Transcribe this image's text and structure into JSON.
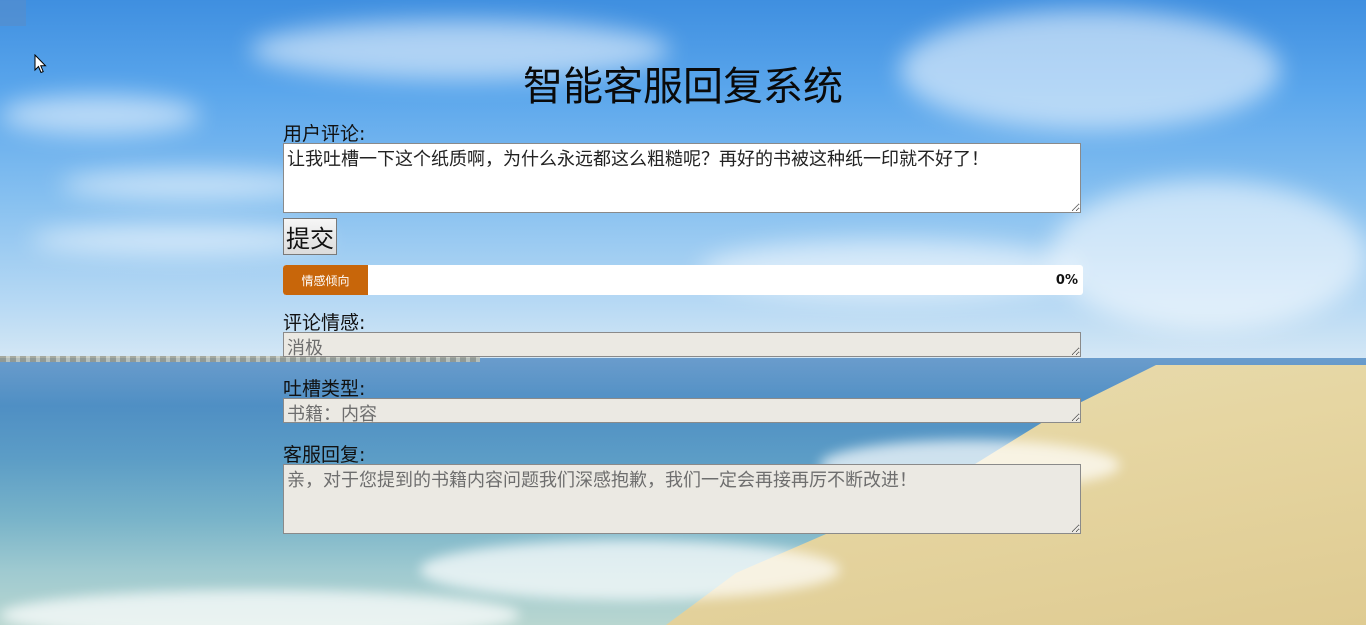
{
  "page": {
    "title": "智能客服回复系统"
  },
  "form": {
    "comment_label": "用户评论:",
    "comment_value": "让我吐槽一下这个纸质啊，为什么永远都这么粗糙呢？再好的书被这种纸一印就不好了！",
    "submit_label": "提交",
    "sentiment_bar": {
      "label": "情感倾向",
      "percent_text": "0%",
      "value": 0,
      "color": "#c8660a"
    },
    "sentiment_label": "评论情感:",
    "sentiment_value": "消极",
    "complaint_type_label": "吐槽类型:",
    "complaint_type_value": "书籍：内容",
    "reply_label": "客服回复:",
    "reply_value": "亲，对于您提到的书籍内容问题我们深感抱歉，我们一定会再接再厉不断改进！"
  },
  "icons": {
    "cursor": "mouse-pointer-icon"
  }
}
